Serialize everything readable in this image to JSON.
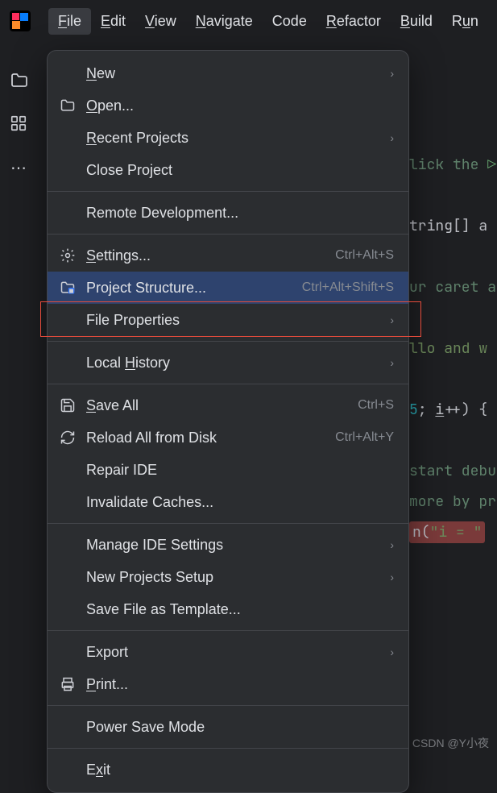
{
  "topmenu": {
    "items": [
      {
        "label": "File",
        "u": 0
      },
      {
        "label": "Edit",
        "u": 0
      },
      {
        "label": "View",
        "u": 0
      },
      {
        "label": "Navigate",
        "u": 0
      },
      {
        "label": "Code",
        "u": -1
      },
      {
        "label": "Refactor",
        "u": 0
      },
      {
        "label": "Build",
        "u": 0
      },
      {
        "label": "Run",
        "u": 1
      }
    ],
    "active_index": 0
  },
  "dropdown": [
    {
      "type": "item",
      "label": "New",
      "u": 0,
      "icon": "",
      "has_sub": true
    },
    {
      "type": "item",
      "label": "Open...",
      "u": 0,
      "icon": "folder"
    },
    {
      "type": "item",
      "label": "Recent Projects",
      "u": 0,
      "has_sub": true
    },
    {
      "type": "item",
      "label": "Close Project"
    },
    {
      "type": "sep"
    },
    {
      "type": "item",
      "label": "Remote Development..."
    },
    {
      "type": "sep"
    },
    {
      "type": "item",
      "label": "Settings...",
      "u": 0,
      "icon": "gear",
      "shortcut": "Ctrl+Alt+S"
    },
    {
      "type": "item",
      "label": "Project Structure...",
      "icon": "project-structure",
      "shortcut": "Ctrl+Alt+Shift+S",
      "selected": true
    },
    {
      "type": "item",
      "label": "File Properties",
      "has_sub": true
    },
    {
      "type": "sep"
    },
    {
      "type": "item",
      "label": "Local History",
      "u": 6,
      "has_sub": true
    },
    {
      "type": "sep"
    },
    {
      "type": "item",
      "label": "Save All",
      "u": 0,
      "icon": "save",
      "shortcut": "Ctrl+S"
    },
    {
      "type": "item",
      "label": "Reload All from Disk",
      "icon": "reload",
      "shortcut": "Ctrl+Alt+Y"
    },
    {
      "type": "item",
      "label": "Repair IDE"
    },
    {
      "type": "item",
      "label": "Invalidate Caches..."
    },
    {
      "type": "sep"
    },
    {
      "type": "item",
      "label": "Manage IDE Settings",
      "has_sub": true
    },
    {
      "type": "item",
      "label": "New Projects Setup",
      "has_sub": true
    },
    {
      "type": "item",
      "label": "Save File as Template..."
    },
    {
      "type": "sep"
    },
    {
      "type": "item",
      "label": "Export",
      "has_sub": true
    },
    {
      "type": "item",
      "label": "Print...",
      "u": 0,
      "icon": "print"
    },
    {
      "type": "sep"
    },
    {
      "type": "item",
      "label": "Power Save Mode"
    },
    {
      "type": "sep"
    },
    {
      "type": "item",
      "label": "Exit",
      "u": 1
    }
  ],
  "code_fragments": {
    "c1": "lick the ",
    "c2": " i",
    "c3": "tring[] a",
    "c4": "ur caret at t",
    "c5": "llo and w",
    "c6": "; ",
    "c7": "i",
    "c8": "++) {",
    "c9": "start debugg",
    "c10": "more by pre",
    "c11": "n(",
    "c12": "\"i = \"",
    "num5": "5"
  },
  "watermark": "CSDN @Y小夜"
}
